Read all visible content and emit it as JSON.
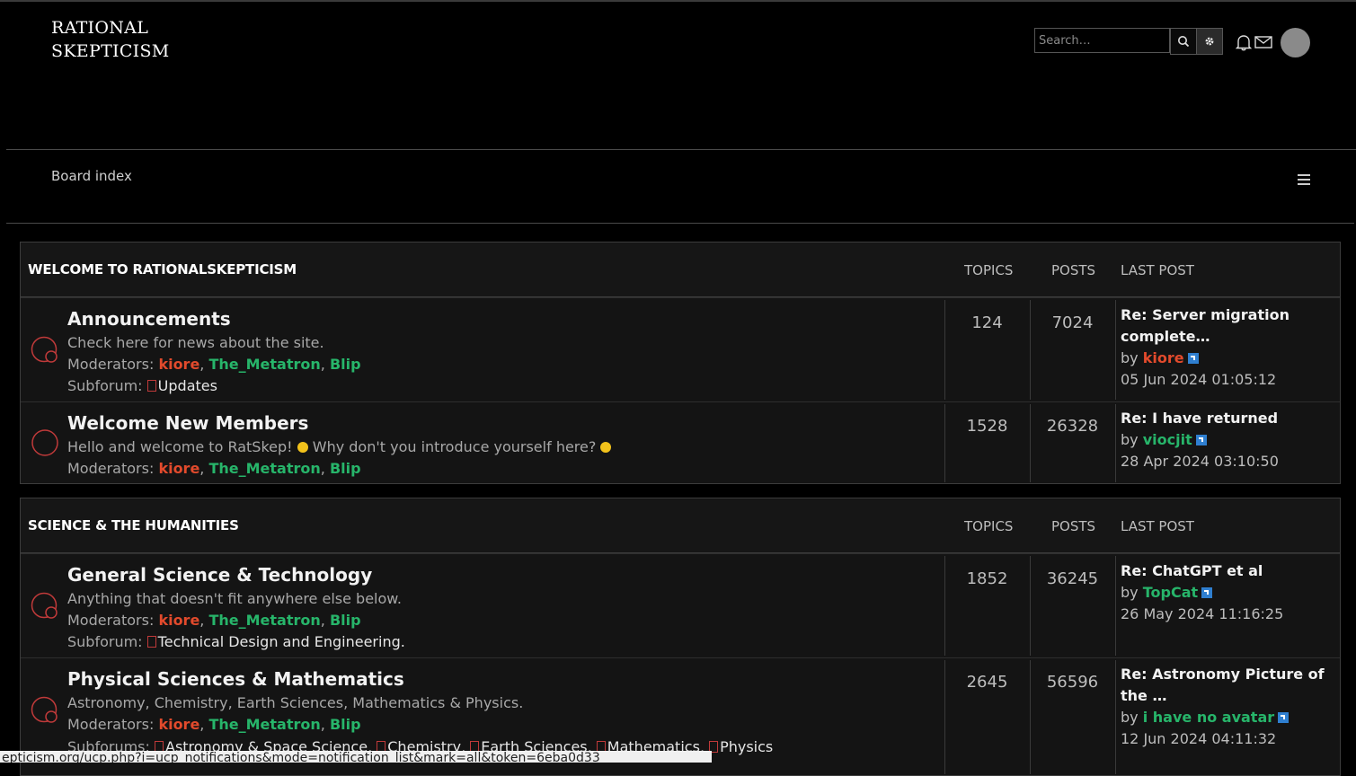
{
  "header": {
    "logo_line1": "RATIONAL",
    "logo_line2": "SKEPTICISM",
    "search_placeholder": "Search…",
    "icons": [
      "search-icon",
      "gear-icon",
      "bell-icon",
      "mail-icon",
      "avatar"
    ]
  },
  "nav": {
    "breadcrumb": "Board index",
    "menu_icon": "hamburger-icon"
  },
  "categories": [
    {
      "title": "WELCOME TO RATIONALSKEPTICISM",
      "col_topics": "TOPICS",
      "col_posts": "POSTS",
      "col_lastpost": "LAST POST",
      "forums": [
        {
          "title": "Announcements",
          "desc": "Check here for news about the site.",
          "moderators_label": "Moderators:",
          "moderators": [
            "kiore",
            "The_Metatron",
            "Blip"
          ],
          "subforum_label": "Subforum:",
          "subforums": [
            "Updates"
          ],
          "topics": "124",
          "posts": "7024",
          "last_title": "Re: Server migration complete…",
          "last_by": "by",
          "last_user": "kiore",
          "last_time": "05 Jun 2024 01:05:12"
        },
        {
          "title": "Welcome New Members",
          "desc_a": "Hello and welcome to RatSkep!",
          "desc_b": "Why don't you introduce yourself here?",
          "moderators_label": "Moderators:",
          "moderators": [
            "kiore",
            "The_Metatron",
            "Blip"
          ],
          "topics": "1528",
          "posts": "26328",
          "last_title": "Re: I have returned",
          "last_by": "by",
          "last_user": "viocjit",
          "last_time": "28 Apr 2024 03:10:50"
        }
      ]
    },
    {
      "title": "SCIENCE & THE HUMANITIES",
      "col_topics": "TOPICS",
      "col_posts": "POSTS",
      "col_lastpost": "LAST POST",
      "forums": [
        {
          "title": "General Science & Technology",
          "desc": "Anything that doesn't fit anywhere else below.",
          "moderators_label": "Moderators:",
          "moderators": [
            "kiore",
            "The_Metatron",
            "Blip"
          ],
          "subforum_label": "Subforum:",
          "subforums": [
            "Technical Design and Engineering."
          ],
          "topics": "1852",
          "posts": "36245",
          "last_title": "Re: ChatGPT et al",
          "last_by": "by",
          "last_user": "TopCat",
          "last_time": "26 May 2024 11:16:25"
        },
        {
          "title": "Physical Sciences & Mathematics",
          "desc": "Astronomy, Chemistry, Earth Sciences, Mathematics & Physics.",
          "moderators_label": "Moderators:",
          "moderators": [
            "kiore",
            "The_Metatron",
            "Blip"
          ],
          "subforum_label": "Subforums:",
          "subforums": [
            "Astronomy & Space Science",
            "Chemistry",
            "Earth Sciences",
            "Mathematics",
            "Physics"
          ],
          "topics": "2645",
          "posts": "56596",
          "last_title": "Re: Astronomy Picture of the …",
          "last_by": "by",
          "last_user": "i have no avatar",
          "last_time": "12 Jun 2024 04:11:32"
        }
      ]
    }
  ],
  "status_bar": "epticism.org/ucp.php?i=ucp_notifications&mode=notification_list&mark=all&token=6eba0d33",
  "colors": {
    "background": "#000000",
    "moderator_red": "#e24a2c",
    "moderator_green": "#27b56a",
    "forum_icon": "#c03a3a",
    "view_icon": "#2f7fd0"
  }
}
